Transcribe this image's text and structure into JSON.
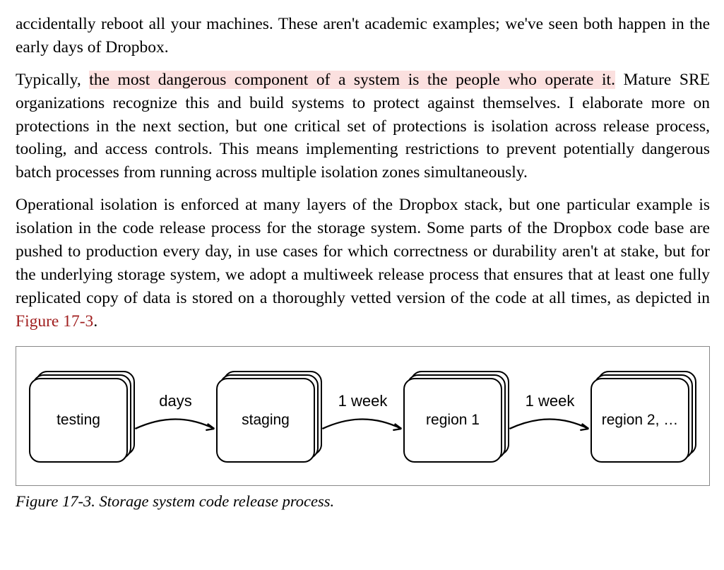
{
  "para1": "accidentally reboot all your machines. These aren't academic examples; we've seen both happen in the early days of Dropbox.",
  "para2_pre": "Typically, ",
  "para2_hl": "the most dangerous component of a system is the people who operate it.",
  "para2_post": " Mature SRE organizations recognize this and build systems to protect against themselves. I elaborate more on protections in the next section, but one critical set of protections is isolation across release process, tooling, and access controls. This means implementing restrictions to prevent potentially dangerous batch processes from running across multiple isolation zones simultaneously.",
  "para3_pre": "Operational isolation is enforced at many layers of the Dropbox stack, but one particular example is isolation in the code release process for the storage system. Some parts of the Dropbox code base are pushed to production every day, in use cases for which correctness or durability aren't at stake, but for the underlying storage system, we adopt a multiweek release process that ensures that at least one fully replicated copy of data is stored on a thoroughly vetted version of the code at all times, as depicted in ",
  "para3_link": "Figure 17-3",
  "para3_post": ".",
  "figure": {
    "caption": "Figure 17-3. Storage system code release process.",
    "stages": [
      {
        "label": "testing"
      },
      {
        "label": "staging"
      },
      {
        "label": "region 1"
      },
      {
        "label": "region 2, …"
      }
    ],
    "connectors": [
      {
        "label": "days"
      },
      {
        "label": "1 week"
      },
      {
        "label": "1 week"
      }
    ]
  }
}
